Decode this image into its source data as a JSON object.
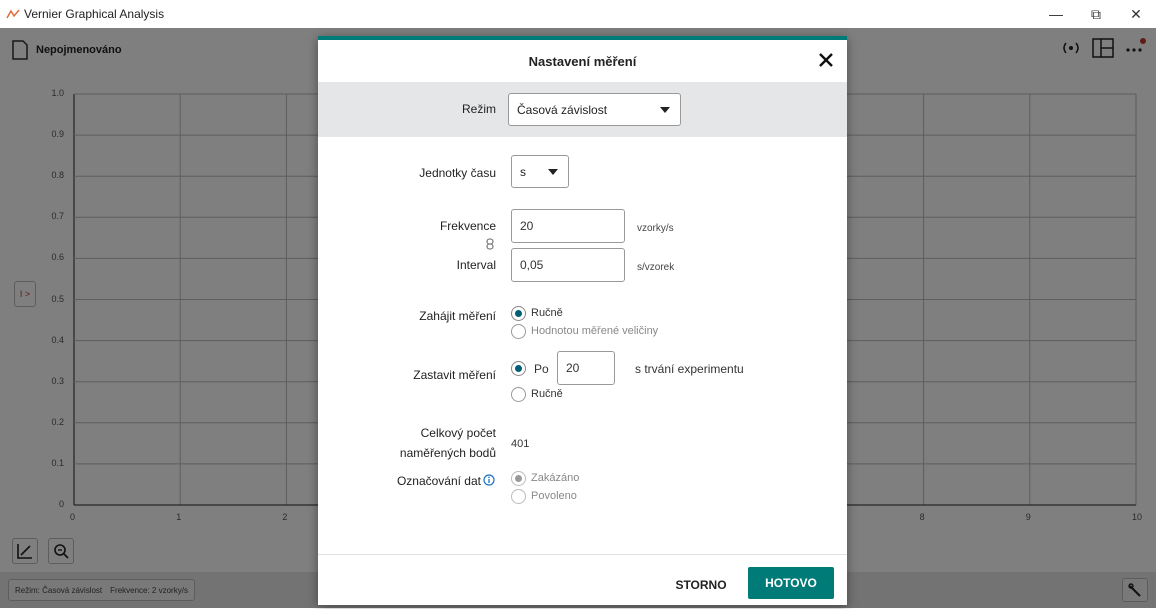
{
  "window": {
    "title": "Vernier Graphical Analysis",
    "minimize": "—",
    "restore": "⧉",
    "close": "✕"
  },
  "document": {
    "title": "Nepojmenováno"
  },
  "graph": {
    "y_ticks": [
      "1.0",
      "0.9",
      "0.8",
      "0.7",
      "0.6",
      "0.5",
      "0.4",
      "0.3",
      "0.2",
      "0.1",
      "0"
    ],
    "x_ticks": [
      "0",
      "1",
      "2",
      "3",
      "4",
      "5",
      "6",
      "7",
      "8",
      "9",
      "10"
    ],
    "side_button": "I >"
  },
  "statusbar": {
    "mode": "Režim: Časová závislost",
    "rate": "Frekvence: 2 vzorky/s"
  },
  "dialog": {
    "title": "Nastavení měření",
    "mode_label": "Režim",
    "mode_value": "Časová závislost",
    "time_units_label": "Jednotky času",
    "time_units_value": "s",
    "rate_label": "Frekvence",
    "rate_value": "20",
    "rate_unit": "vzorky/s",
    "interval_label": "Interval",
    "interval_value": "0,05",
    "interval_unit": "s/vzorek",
    "start_label": "Zahájit měření",
    "start_options": [
      "Ručně",
      "Hodnotou měřené veličiny"
    ],
    "stop_label": "Zastavit měření",
    "stop_after": "Po",
    "stop_duration": "20",
    "stop_suffix": "s trvání experimentu",
    "stop_manual": "Ručně",
    "total_label_1": "Celkový počet",
    "total_label_2": "naměřených bodů",
    "total_value": "401",
    "tagging_label": "Označování dat",
    "tagging_options": [
      "Zakázáno",
      "Povoleno"
    ],
    "cancel": "STORNO",
    "done": "HOTOVO"
  },
  "colors": {
    "accent": "#007b78",
    "radio": "#005f73",
    "notification_dot": "#c0392b"
  }
}
